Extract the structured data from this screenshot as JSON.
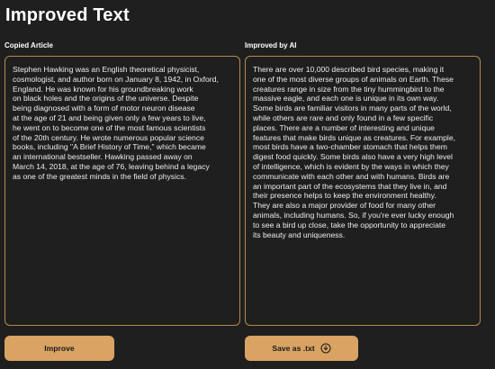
{
  "page": {
    "title": "Improved Text"
  },
  "left": {
    "label": "Copied Article",
    "text": "Stephen Hawking was an English theoretical physicist,\ncosmologist, and author born on January 8, 1942, in Oxford,\n England. He was known for his groundbreaking work\non black holes and the origins of the universe. Despite\nbeing diagnosed with a form of motor neuron disease\nat the age of 21 and being given only a few years to live,\nhe went on to become one of the most famous scientists\nof the 20th century. He wrote numerous popular science\nbooks, including \"A Brief History of Time,\" which became\nan international bestseller. Hawking passed away on\nMarch 14, 2018, at the age of 76, leaving behind a legacy\nas one of the greatest minds in the field of physics."
  },
  "right": {
    "label": "Improved by AI",
    "text": "There are over 10,000 described bird species, making it\none of the most diverse groups of animals on Earth. These\ncreatures range in size from the tiny hummingbird to the\nmassive eagle, and each one is unique in its own way.\nSome birds are familiar visitors in many parts of the world,\nwhile others are rare and only found in a few specific\nplaces. There are a number of interesting and unique\nfeatures that make birds unique as creatures. For example,\nmost birds have a two-chamber stomach that helps them\ndigest food quickly. Some birds also have a very high level\nof intelligence, which is evident by the ways in which they\ncommunicate with each other and with humans. Birds are\nan important part of the ecosystems that they live in, and\ntheir presence helps to keep the environment healthy.\nThey are also a major provider of food for many other\nanimals, including humans. So, if you're ever lucky enough\nto see a bird up close, take the opportunity to appreciate\nits beauty and uniqueness."
  },
  "buttons": {
    "improve": "Improve",
    "save": "Save as .txt",
    "save_icon": "download-circle-icon"
  },
  "colors": {
    "background": "#1f1f1f",
    "accent": "#d8a363",
    "panel_border": "#b48a4a"
  }
}
